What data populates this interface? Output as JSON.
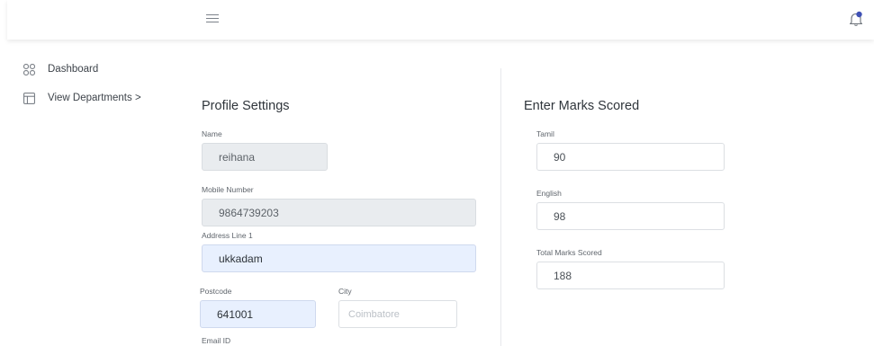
{
  "header": {
    "menu_icon": "hamburger-icon",
    "notification_icon": "bell-icon"
  },
  "sidebar": {
    "items": [
      {
        "label": "Dashboard",
        "icon": "grid-icon"
      },
      {
        "label": "View Departments >",
        "icon": "table-icon"
      }
    ]
  },
  "profile": {
    "title": "Profile Settings",
    "name": {
      "label": "Name",
      "value": "reihana"
    },
    "mobile": {
      "label": "Mobile Number",
      "value": "9864739203"
    },
    "address": {
      "label": "Address Line 1",
      "value": "ukkadam"
    },
    "postcode": {
      "label": "Postcode",
      "value": "641001"
    },
    "city": {
      "label": "City",
      "placeholder": "Coimbatore"
    },
    "email": {
      "label": "Email ID"
    }
  },
  "marks": {
    "title": "Enter Marks Scored",
    "tamil": {
      "label": "Tamil",
      "value": "90"
    },
    "english": {
      "label": "English",
      "value": "98"
    },
    "total": {
      "label": "Total Marks Scored",
      "value": "188"
    }
  },
  "colors": {
    "accent": "#3f51b5",
    "filled_field": "#e8f0fe",
    "disabled_field": "#e9ecef"
  }
}
